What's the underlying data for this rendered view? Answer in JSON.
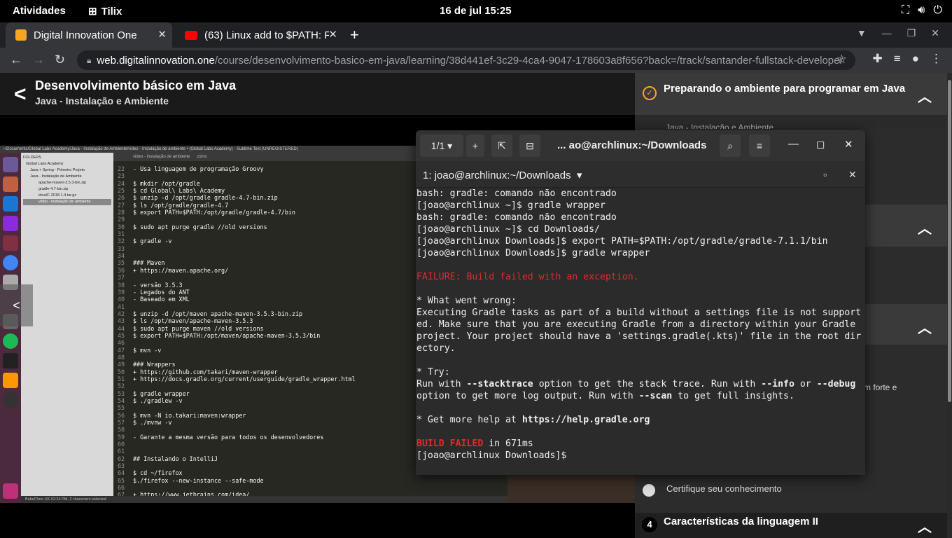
{
  "topbar": {
    "activities": "Atividades",
    "app": "Tilix",
    "clock": "16 de jul  15:25"
  },
  "tabs": [
    {
      "title": "Digital Innovation One",
      "favicon_color": "#f5a623"
    },
    {
      "title": "(63) Linux add to $PATH: F",
      "favicon_color": "#ff0000"
    }
  ],
  "omnibox": {
    "host": "web.digitalinnovation.one",
    "path": "/course/desenvolvimento-basico-em-java/learning/38d441ef-3c29-4ca4-9047-178603a8f656?back=/track/santander-fullstack-developer"
  },
  "course": {
    "title": "Desenvolvimento básico em Java",
    "subtitle": "Java - Instalação e Ambiente"
  },
  "right_panel": {
    "section1": "Preparando o ambiente para programar em Java",
    "section1_sub": "Java - Instalação e Ambiente",
    "cert": "Certifique seu conhecimento",
    "forte": "m forte e",
    "section4_num": "4",
    "section4": "Características da linguagem II"
  },
  "sublime": {
    "title": "~/Documents/Global Labs Academy/Java - Instalação de Ambiente/video - Instalação de ambiente • (Global Labs Academy) - Sublime Text (UNREGISTERED)",
    "tabs": [
      "video - instalação de ambiente",
      "zshrc"
    ],
    "folders": [
      "FOLDERS",
      "Global Labs Academy",
      "Java + Spring - Primeiro Projeto",
      "Java - Instalação de Ambiente",
      "apache-maven-3.5.3-bin.zip",
      "gradle-4.7-bin.zip",
      "ideaIC-2018.1.4.tar.gz",
      "video - instalação de ambiente"
    ],
    "status": "BabelTime UK 02:24 PM, 2 characters selected",
    "lines": [
      {
        "n": "22",
        "t": "- Usa linguagem de programação Groovy"
      },
      {
        "n": "23",
        "t": ""
      },
      {
        "n": "24",
        "t": "$ mkdir /opt/gradle"
      },
      {
        "n": "25",
        "t": "$ cd Global\\ Labs\\ Academy"
      },
      {
        "n": "26",
        "t": "$ unzip -d /opt/gradle gradle-4.7-bin.zip"
      },
      {
        "n": "27",
        "t": "$ ls /opt/gradle/gradle-4.7"
      },
      {
        "n": "28",
        "t": "$ export PATH=$PATH:/opt/gradle/gradle-4.7/bin"
      },
      {
        "n": "29",
        "t": ""
      },
      {
        "n": "30",
        "t": "$ sudo apt purge gradle //old versions"
      },
      {
        "n": "31",
        "t": ""
      },
      {
        "n": "32",
        "t": "$ gradle -v"
      },
      {
        "n": "33",
        "t": ""
      },
      {
        "n": "34",
        "t": ""
      },
      {
        "n": "35",
        "t": "### Maven"
      },
      {
        "n": "36",
        "t": "+ https://maven.apache.org/"
      },
      {
        "n": "37",
        "t": ""
      },
      {
        "n": "38",
        "t": "- versão 3.5.3"
      },
      {
        "n": "39",
        "t": "- Legados do ANT"
      },
      {
        "n": "40",
        "t": "- Baseado em XML"
      },
      {
        "n": "41",
        "t": ""
      },
      {
        "n": "42",
        "t": "$ unzip -d /opt/maven apache-maven-3.5.3-bin.zip"
      },
      {
        "n": "43",
        "t": "$ ls /opt/maven/apache-maven-3.5.3"
      },
      {
        "n": "44",
        "t": "$ sudo apt purge maven //old versions"
      },
      {
        "n": "45",
        "t": "$ export PATH=$PATH:/opt/maven/apache-maven-3.5.3/bin"
      },
      {
        "n": "46",
        "t": ""
      },
      {
        "n": "47",
        "t": "$ mvn -v"
      },
      {
        "n": "48",
        "t": ""
      },
      {
        "n": "49",
        "t": "### Wrappers"
      },
      {
        "n": "50",
        "t": "+ https://github.com/takari/maven-wrapper"
      },
      {
        "n": "51",
        "t": "+ https://docs.gradle.org/current/userguide/gradle_wrapper.html"
      },
      {
        "n": "52",
        "t": ""
      },
      {
        "n": "53",
        "t": "$ gradle wrapper"
      },
      {
        "n": "54",
        "t": "$ ./gradlew -v"
      },
      {
        "n": "55",
        "t": ""
      },
      {
        "n": "56",
        "t": "$ mvn -N io.takari:maven:wrapper"
      },
      {
        "n": "57",
        "t": "$ ./mvnw -v"
      },
      {
        "n": "58",
        "t": ""
      },
      {
        "n": "59",
        "t": "- Garante a mesma versão para todos os desenvolvedores"
      },
      {
        "n": "60",
        "t": ""
      },
      {
        "n": "61",
        "t": ""
      },
      {
        "n": "62",
        "t": "## Instalando o IntelliJ"
      },
      {
        "n": "63",
        "t": ""
      },
      {
        "n": "64",
        "t": "$ cd ~/firefox"
      },
      {
        "n": "65",
        "t": "$./firefox --new-instance --safe-mode"
      },
      {
        "n": "66",
        "t": ""
      },
      {
        "n": "67",
        "t": "+ https://www.jetbrains.com/idea/"
      }
    ]
  },
  "tilix": {
    "counter": "1/1",
    "title": "... ao@archlinux:~/Downloads",
    "session": "1: joao@archlinux:~/Downloads",
    "lines": [
      {
        "t": "bash: gradle: comando não encontrado",
        "s": ""
      },
      {
        "t": "[joao@archlinux ~]$ gradle wrapper",
        "s": ""
      },
      {
        "t": "bash: gradle: comando não encontrado",
        "s": ""
      },
      {
        "t": "[joao@archlinux ~]$ cd Downloads/",
        "s": ""
      },
      {
        "t": "[joao@archlinux Downloads]$ export PATH=$PATH:/opt/gradle/gradle-7.1.1/bin",
        "s": ""
      },
      {
        "t": "[joao@archlinux Downloads]$ gradle wrapper",
        "s": ""
      },
      {
        "t": "",
        "s": ""
      },
      {
        "t": "FAILURE: Build failed with an exception.",
        "s": "red"
      },
      {
        "t": "",
        "s": ""
      },
      {
        "t": "* What went wrong:",
        "s": ""
      },
      {
        "t": "Executing Gradle tasks as part of a build without a settings file is not support",
        "s": ""
      },
      {
        "t": "ed. Make sure that you are executing Gradle from a directory within your Gradle",
        "s": ""
      },
      {
        "t": "project. Your project should have a 'settings.gradle(.kts)' file in the root dir",
        "s": ""
      },
      {
        "t": "ectory.",
        "s": ""
      },
      {
        "t": "",
        "s": ""
      },
      {
        "t": "* Try:",
        "s": ""
      }
    ],
    "try1": {
      "a": "Run with ",
      "b": "--stacktrace",
      "c": " option to get the stack trace. Run with ",
      "d": "--info",
      "e": " or ",
      "f": "--debug"
    },
    "try2": {
      "a": "option to get more log output. Run with ",
      "b": "--scan",
      "c": " to get full insights."
    },
    "help": {
      "a": "* Get more help at ",
      "b": "https://help.gradle.org"
    },
    "build": {
      "a": "BUILD FAILED",
      "b": " in 671ms"
    },
    "prompt": "[joao@archlinux Downloads]$ "
  }
}
